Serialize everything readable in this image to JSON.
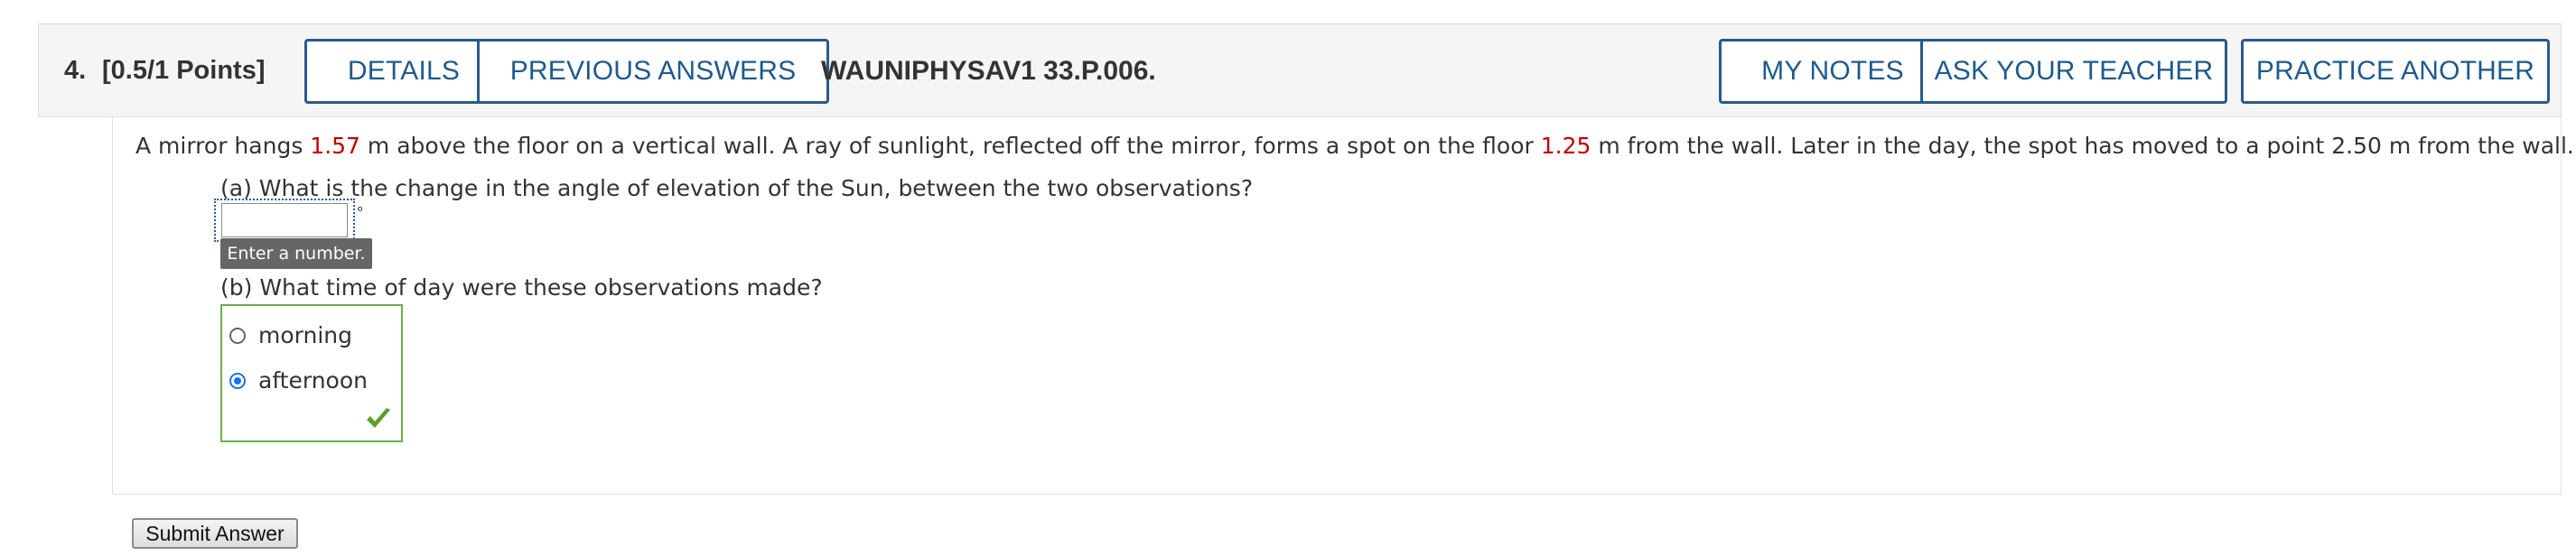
{
  "header": {
    "question_number": "4.",
    "points": "[0.5/1 Points]",
    "details_label": "DETAILS",
    "previous_answers_label": "PREVIOUS ANSWERS",
    "assignment_code": "WAUNIPHYSAV1 33.P.006.",
    "my_notes_label": "MY NOTES",
    "ask_teacher_label": "ASK YOUR TEACHER",
    "practice_label": "PRACTICE ANOTHER"
  },
  "problem": {
    "text_1": "A mirror hangs ",
    "value_1": "1.57",
    "text_2": " m above the floor on a vertical wall. A ray of sunlight, reflected off the mirror, forms a spot on the floor ",
    "value_2": "1.25",
    "text_3": " m from the wall. Later in the day, the spot has moved to a point 2.50 m from the wall."
  },
  "part_a": {
    "question": "(a) What is the change in the angle of elevation of the Sun, between the two observations?",
    "input_value": "",
    "unit": "°",
    "tooltip": "Enter a number."
  },
  "part_b": {
    "question": "(b) What time of day were these observations made?",
    "options": [
      {
        "label": "morning",
        "selected": false
      },
      {
        "label": "afternoon",
        "selected": true
      }
    ],
    "correct_icon": "checkmark-icon"
  },
  "submit_label": "Submit Answer",
  "colors": {
    "button_border": "#2a5a8a",
    "highlight_value": "#c00000",
    "correct_border": "#6ab04c",
    "radio_selected": "#1a73e8"
  }
}
